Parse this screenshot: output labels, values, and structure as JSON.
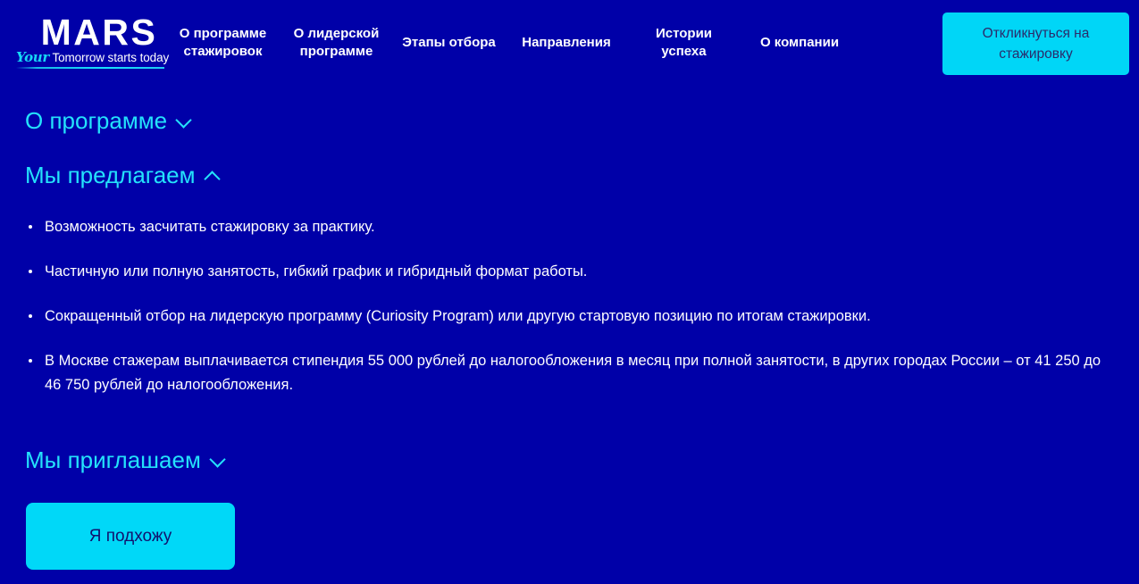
{
  "theme": {
    "background": "#0000a8",
    "accent_cyan": "#00d8f8",
    "heading_cyan": "#24e2fb",
    "text_white": "#ffffff",
    "button_text_dark": "#12126e"
  },
  "header": {
    "logo": {
      "wordmark": "MARS",
      "tagline_script": "Your",
      "tagline_rest": " Tomorrow starts today"
    },
    "nav": [
      {
        "label": "О программе стажировок"
      },
      {
        "label": "О лидерской программе"
      },
      {
        "label": "Этапы отбора"
      },
      {
        "label": "Направления"
      },
      {
        "label": "Истории успеха"
      },
      {
        "label": "О компании"
      }
    ],
    "cta": {
      "label": "Откликнуться на стажировку"
    }
  },
  "main": {
    "sections": [
      {
        "title": "О программе",
        "expanded": false,
        "icon": "chevron-down-icon"
      },
      {
        "title": "Мы предлагаем",
        "expanded": true,
        "icon": "chevron-up-icon"
      },
      {
        "title": "Мы приглашаем",
        "expanded": false,
        "icon": "chevron-down-icon"
      }
    ],
    "offers": [
      "Возможность засчитать стажировку за практику.",
      "Частичную или полную занятость, гибкий график и гибридный формат работы.",
      "Сокращенный отбор на лидерскую программу (Curiosity Program) или другую стартовую позицию по итогам стажировки.",
      "В Москве стажерам выплачивается стипендия 55 000 рублей до налогообложения в месяц при полной занятости, в других городах России – от 41 250 до 46 750 рублей до налогообложения."
    ],
    "apply_button": {
      "label": "Я подхожу"
    }
  }
}
